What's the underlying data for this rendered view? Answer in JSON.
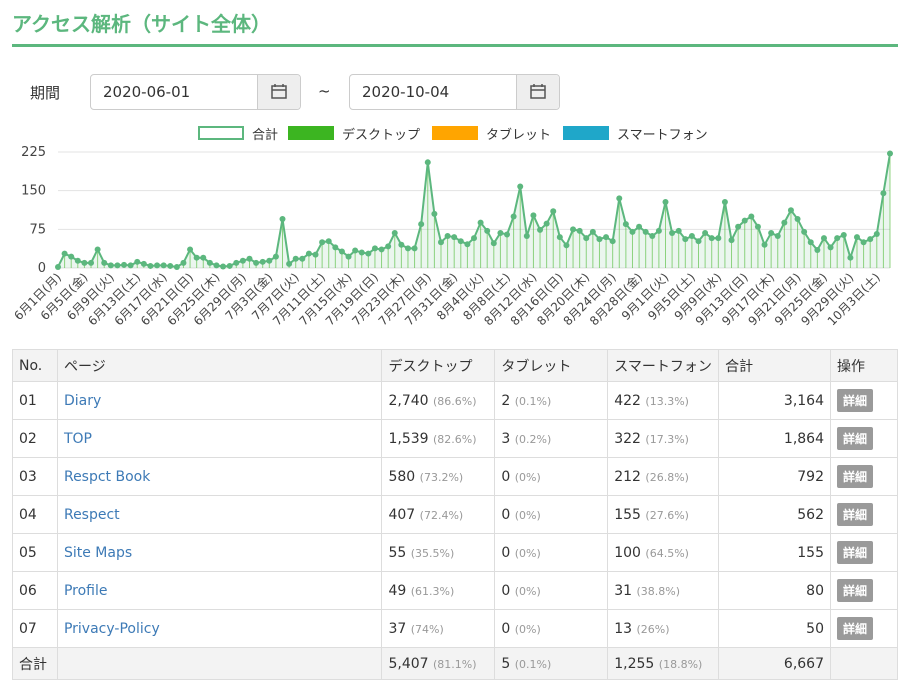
{
  "title": "アクセス解析（サイト全体）",
  "period": {
    "label": "期間",
    "start": "2020-06-01",
    "end": "2020-10-04",
    "separator": "~"
  },
  "legend": [
    {
      "label": "合計",
      "color": "#5cb77e",
      "outline": true
    },
    {
      "label": "デスクトップ",
      "color": "#3cb521",
      "outline": false
    },
    {
      "label": "タブレット",
      "color": "#ffa500",
      "outline": false
    },
    {
      "label": "スマートフォン",
      "color": "#1fa7c9",
      "outline": false
    }
  ],
  "chart_data": {
    "type": "line",
    "ylim": [
      0,
      225
    ],
    "yticks": [
      0,
      75,
      150,
      225
    ],
    "x_tick_labels": [
      "6月1日(月)",
      "6月5日(金)",
      "6月9日(火)",
      "6月13日(土)",
      "6月17日(水)",
      "6月21日(日)",
      "6月25日(木)",
      "6月29日(月)",
      "7月3日(金)",
      "7月7日(火)",
      "7月11日(土)",
      "7月15日(水)",
      "7月19日(日)",
      "7月23日(木)",
      "7月27日(月)",
      "7月31日(金)",
      "8月4日(火)",
      "8月8日(土)",
      "8月12日(水)",
      "8月16日(日)",
      "8月20日(木)",
      "8月24日(月)",
      "8月28日(金)",
      "9月1日(火)",
      "9月5日(土)",
      "9月9日(水)",
      "9月13日(日)",
      "9月17日(木)",
      "9月21日(月)",
      "9月25日(金)",
      "9月29日(火)",
      "10月3日(土)"
    ],
    "series": [
      {
        "name": "合計",
        "color": "#5cb77e",
        "values": [
          2,
          28,
          22,
          14,
          10,
          10,
          36,
          10,
          5,
          5,
          6,
          5,
          12,
          8,
          4,
          5,
          5,
          4,
          2,
          10,
          36,
          20,
          20,
          10,
          5,
          3,
          4,
          10,
          14,
          18,
          10,
          12,
          14,
          22,
          95,
          8,
          18,
          18,
          28,
          26,
          50,
          52,
          40,
          32,
          22,
          34,
          30,
          28,
          38,
          36,
          42,
          68,
          45,
          38,
          38,
          85,
          205,
          105,
          50,
          62,
          60,
          52,
          46,
          58,
          88,
          72,
          48,
          68,
          65,
          100,
          158,
          62,
          102,
          74,
          86,
          110,
          60,
          44,
          75,
          72,
          58,
          70,
          56,
          60,
          52,
          135,
          85,
          70,
          80,
          70,
          62,
          72,
          128,
          68,
          72,
          56,
          62,
          52,
          68,
          58,
          58,
          128,
          54,
          80,
          92,
          100,
          80,
          45,
          68,
          62,
          88,
          112,
          95,
          70,
          50,
          35,
          58,
          40,
          58,
          64,
          20,
          60,
          50,
          56,
          66,
          145,
          222
        ]
      }
    ]
  },
  "table": {
    "headers": {
      "no": "No.",
      "page": "ページ",
      "desktop": "デスクトップ",
      "tablet": "タブレット",
      "smartphone": "スマートフォン",
      "total": "合計",
      "action": "操作"
    },
    "detail_label": "詳細",
    "rows": [
      {
        "no": "01",
        "page": "Diary",
        "desktop": "2,740",
        "desktop_pct": "(86.6%)",
        "tablet": "2",
        "tablet_pct": "(0.1%)",
        "smartphone": "422",
        "smartphone_pct": "(13.3%)",
        "total": "3,164"
      },
      {
        "no": "02",
        "page": "TOP",
        "desktop": "1,539",
        "desktop_pct": "(82.6%)",
        "tablet": "3",
        "tablet_pct": "(0.2%)",
        "smartphone": "322",
        "smartphone_pct": "(17.3%)",
        "total": "1,864"
      },
      {
        "no": "03",
        "page": "Respct Book",
        "desktop": "580",
        "desktop_pct": "(73.2%)",
        "tablet": "0",
        "tablet_pct": "(0%)",
        "smartphone": "212",
        "smartphone_pct": "(26.8%)",
        "total": "792"
      },
      {
        "no": "04",
        "page": "Respect",
        "desktop": "407",
        "desktop_pct": "(72.4%)",
        "tablet": "0",
        "tablet_pct": "(0%)",
        "smartphone": "155",
        "smartphone_pct": "(27.6%)",
        "total": "562"
      },
      {
        "no": "05",
        "page": "Site Maps",
        "desktop": "55",
        "desktop_pct": "(35.5%)",
        "tablet": "0",
        "tablet_pct": "(0%)",
        "smartphone": "100",
        "smartphone_pct": "(64.5%)",
        "total": "155"
      },
      {
        "no": "06",
        "page": "Profile",
        "desktop": "49",
        "desktop_pct": "(61.3%)",
        "tablet": "0",
        "tablet_pct": "(0%)",
        "smartphone": "31",
        "smartphone_pct": "(38.8%)",
        "total": "80"
      },
      {
        "no": "07",
        "page": "Privacy-Policy",
        "desktop": "37",
        "desktop_pct": "(74%)",
        "tablet": "0",
        "tablet_pct": "(0%)",
        "smartphone": "13",
        "smartphone_pct": "(26%)",
        "total": "50"
      }
    ],
    "footer": {
      "label": "合計",
      "desktop": "5,407",
      "desktop_pct": "(81.1%)",
      "tablet": "5",
      "tablet_pct": "(0.1%)",
      "smartphone": "1,255",
      "smartphone_pct": "(18.8%)",
      "total": "6,667"
    }
  }
}
